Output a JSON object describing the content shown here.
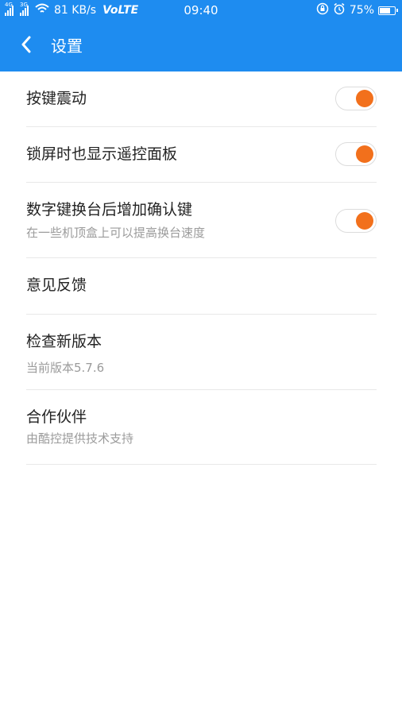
{
  "status_bar": {
    "network_left": "4G",
    "network_right": "3G",
    "speed": "81 KB/s",
    "volte": "VoLTE",
    "time": "09:40",
    "battery": "75%",
    "battery_level": 0.75,
    "icons": [
      "signal-icon",
      "wifi-icon",
      "rotation-lock-icon",
      "alarm-icon",
      "battery-icon"
    ]
  },
  "app_bar": {
    "title": "设置",
    "back_icon": "chevron-left-icon",
    "background": "#1e8cf0"
  },
  "settings": {
    "items": [
      {
        "title": "按键震动",
        "toggle": true
      },
      {
        "title": "锁屏时也显示遥控面板",
        "toggle": true
      },
      {
        "title": "数字键换台后增加确认键",
        "subtitle": "在一些机顶盒上可以提高换台速度",
        "toggle": true
      },
      {
        "title": "意见反馈"
      },
      {
        "title": "检查新版本",
        "subtitle": "当前版本5.7.6"
      },
      {
        "title": "合作伙伴",
        "subtitle": "由酷控提供技术支持"
      }
    ]
  },
  "colors": {
    "accent": "#1e8cf0",
    "toggle_on": "#f2701c"
  }
}
